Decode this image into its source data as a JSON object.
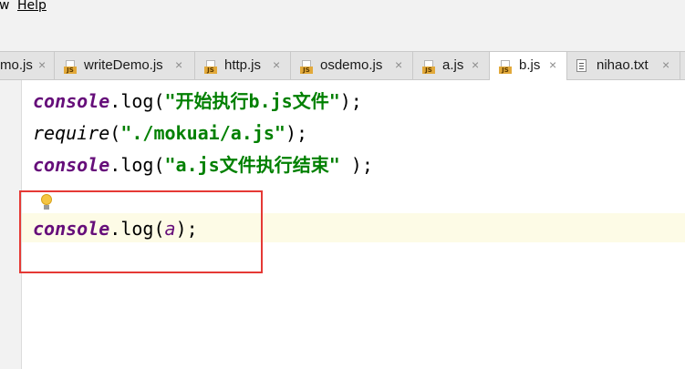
{
  "menu": {
    "partial": "w",
    "help": "Help"
  },
  "tabs": [
    {
      "label": "mo.js",
      "icon": "js-file-icon",
      "active": false
    },
    {
      "label": "writeDemo.js",
      "icon": "js-file-icon",
      "active": false
    },
    {
      "label": "http.js",
      "icon": "js-file-icon",
      "active": false
    },
    {
      "label": "osdemo.js",
      "icon": "js-file-icon",
      "active": false
    },
    {
      "label": "a.js",
      "icon": "js-file-icon",
      "active": false
    },
    {
      "label": "b.js",
      "icon": "js-file-icon",
      "active": true
    },
    {
      "label": "nihao.txt",
      "icon": "text-file-icon",
      "active": false
    }
  ],
  "close_glyph": "×",
  "code": {
    "line1": {
      "obj": "console",
      "dot": ".",
      "method": "log",
      "open": "(",
      "string": "\"开始执行b.js文件\"",
      "close": ");"
    },
    "line2": {
      "fn": "require",
      "open": "(",
      "string": "\"./mokuai/a.js\"",
      "close": ");"
    },
    "line3": {
      "obj": "console",
      "dot": ".",
      "method": "log",
      "open": "(",
      "string": "\"a.js文件执行结束\"",
      "close": " );"
    },
    "line4": {
      "obj": "console",
      "dot": ".",
      "method": "log",
      "open": "(",
      "arg": "a",
      "close": ");"
    }
  },
  "colors": {
    "keyword": "#660e7a",
    "string": "#008000",
    "highlight_box": "#e53935",
    "caret_line": "#fdfbe6"
  }
}
